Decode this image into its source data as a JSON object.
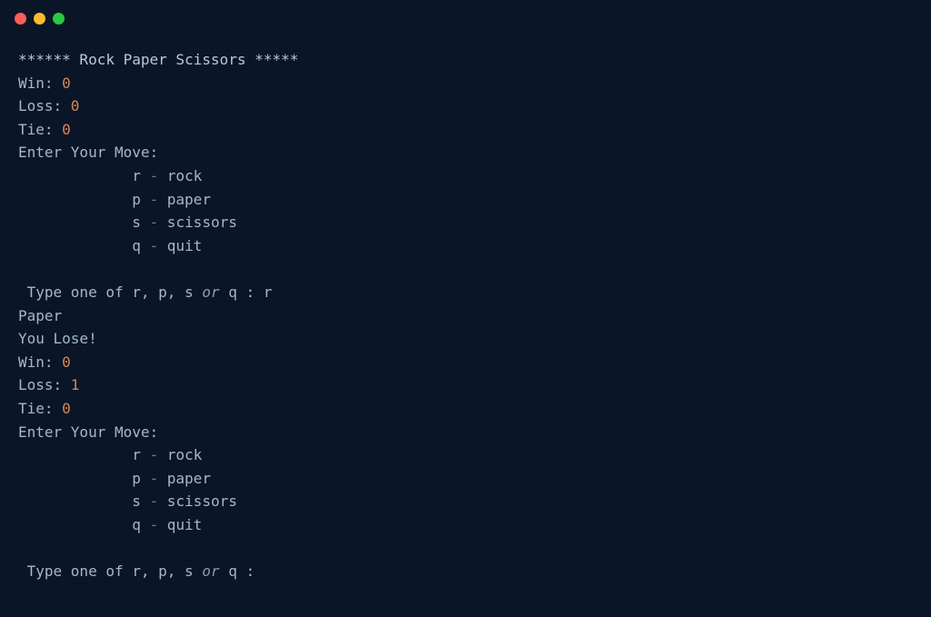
{
  "title_line": "****** Rock Paper Scissors *****",
  "round1": {
    "win_label": "Win: ",
    "win_value": "0",
    "loss_label": "Loss: ",
    "loss_value": "0",
    "tie_label": "Tie: ",
    "tie_value": "0"
  },
  "enter_move": "Enter Your Move:",
  "options": {
    "r": {
      "key": "r",
      "dash": " - ",
      "name": "rock"
    },
    "p": {
      "key": "p",
      "dash": " - ",
      "name": "paper"
    },
    "s": {
      "key": "s",
      "dash": " - ",
      "name": "scissors"
    },
    "q": {
      "key": "q",
      "dash": " - ",
      "name": "quit"
    }
  },
  "prompt_prefix": " Type one of r, p, s ",
  "prompt_or": "or",
  "prompt_suffix_with_input": " q : r",
  "prompt_suffix_no_input": " q : ",
  "result_move": "Paper",
  "result_text": "You Lose!",
  "round2": {
    "win_label": "Win: ",
    "win_value": "0",
    "loss_label": "Loss: ",
    "loss_value": "1",
    "tie_label": "Tie: ",
    "tie_value": "0"
  },
  "indent": "             "
}
